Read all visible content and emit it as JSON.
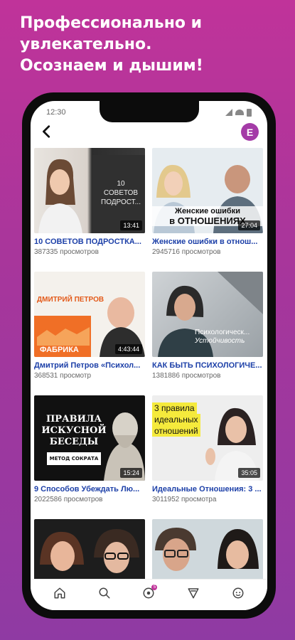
{
  "headline": {
    "line1": "Профессионально и",
    "line2": "увлекательно.",
    "line3": "Осознаем и дышим!"
  },
  "status_bar": {
    "time": "12:30"
  },
  "appbar": {
    "avatar_letter": "E",
    "back_icon": "back-arrow-icon"
  },
  "videos": [
    {
      "title": "10 СОВЕТОВ ПОДРОСТКА...",
      "views": "387335 просмотров",
      "duration": "13:41",
      "overlay": [
        "10",
        "СОВЕТОВ",
        "ПОДРОСТ..."
      ]
    },
    {
      "title": "Женские ошибки в отнош...",
      "views": "2945716 просмотров",
      "duration": "27:04",
      "overlay": [
        "Женские ошибки",
        "в ОТНОШЕНИЯХ"
      ]
    },
    {
      "title": "Дмитрий Петров «Психол...",
      "views": "368531 просмотр",
      "duration": "4:43:44",
      "overlay": [
        "ДМИТРИЙ ПЕТРОВ",
        "ФАБРИКА"
      ]
    },
    {
      "title": "КАК БЫТЬ ПСИХОЛОГИЧЕ...",
      "views": "1381886 просмотров",
      "duration": "",
      "overlay": [
        "Психологическ...",
        "Устойчивость"
      ]
    },
    {
      "title": "9 Способов Убеждать Лю...",
      "views": "2022586 просмотров",
      "duration": "15:24",
      "overlay": [
        "ПРАВИЛА",
        "ИСКУСНОЙ",
        "БЕСЕДЫ",
        "МЕТОД СОКРАТА"
      ]
    },
    {
      "title": "Идеальные Отношения: 3 ...",
      "views": "3011952 просмотра",
      "duration": "35:05",
      "overlay": [
        "3 правила",
        "идеальных",
        "отношений"
      ]
    },
    {
      "title": "",
      "views": "",
      "duration": "",
      "overlay": []
    },
    {
      "title": "",
      "views": "",
      "duration": "",
      "overlay": []
    }
  ],
  "bottom_nav": [
    {
      "icon": "home-icon",
      "badge": ""
    },
    {
      "icon": "search-icon",
      "badge": ""
    },
    {
      "icon": "notifications-icon",
      "badge": "5"
    },
    {
      "icon": "send-icon",
      "badge": ""
    },
    {
      "icon": "profile-icon",
      "badge": ""
    }
  ],
  "colors": {
    "accent": "#a43ba7",
    "link": "#1d40a8",
    "bg_top": "#c0339a",
    "bg_bottom": "#8f3aa3"
  }
}
